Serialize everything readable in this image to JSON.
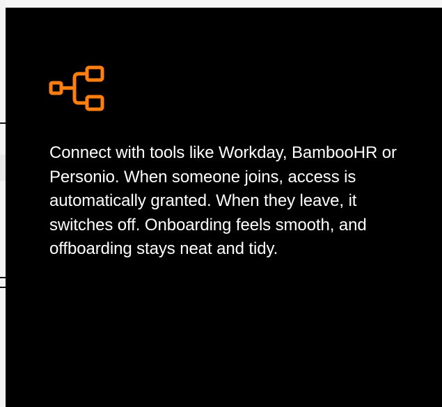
{
  "card": {
    "background_color": "#000000",
    "icon": "hierarchy-connection-icon",
    "icon_color": "#ff7f11",
    "description": "Connect with tools like Workday, BambooHR or Personio. When someone joins, access is automatically granted. When they leave, it switches off. Onboarding feels smooth, and offboarding stays neat and tidy."
  }
}
